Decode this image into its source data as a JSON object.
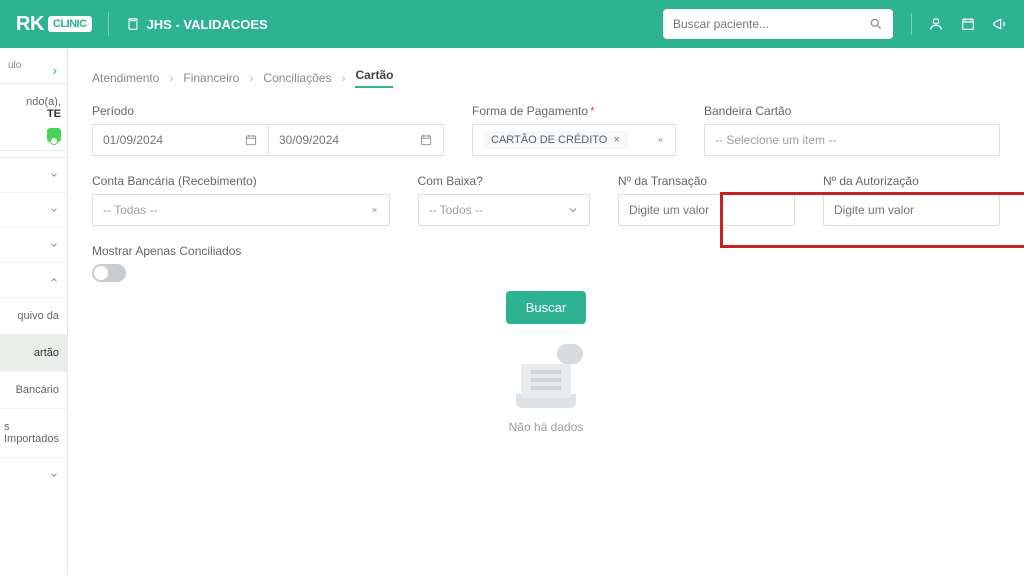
{
  "header": {
    "brand_left": "RK",
    "brand_badge": "CLINIC",
    "clinic_name": "JHS - VALIDACOES",
    "search_placeholder": "Buscar paciente..."
  },
  "sidebar": {
    "mini": "ulo",
    "welcome_line1": "ndo(a),",
    "welcome_line2": "TE",
    "items": [
      {
        "label": "",
        "expand": true
      },
      {
        "label": "",
        "expand": true
      },
      {
        "label": "",
        "expand": true
      },
      {
        "label": "",
        "collapse": true
      },
      {
        "label": "quivo da"
      },
      {
        "label": "artão",
        "active": true
      },
      {
        "label": "Bancário"
      },
      {
        "label": "s Importados"
      },
      {
        "label": "",
        "expand": true
      }
    ]
  },
  "breadcrumb": {
    "a": "Atendimento",
    "b": "Financeiro",
    "c": "Conciliações",
    "d": "Cartão"
  },
  "labels": {
    "periodo": "Período",
    "forma_pag": "Forma de Pagamento",
    "bandeira": "Bandeira Cartão",
    "conta": "Conta Bancária (Recebimento)",
    "com_baixa": "Com Baixa?",
    "n_trans": "Nº da Transação",
    "n_auth": "Nº da Autorização",
    "mostrar": "Mostrar Apenas Conciliados"
  },
  "values": {
    "date_start": "01/09/2024",
    "date_end": "30/09/2024",
    "forma_pag_chip": "CARTÃO DE CRÉDITO",
    "bandeira_ph": "-- Selecione um item --",
    "conta_ph": "-- Todas --",
    "com_baixa_ph": "-- Todos --",
    "digite_ph": "Digite um valor"
  },
  "actions": {
    "buscar": "Buscar"
  },
  "empty": {
    "text": "Não há dados"
  }
}
